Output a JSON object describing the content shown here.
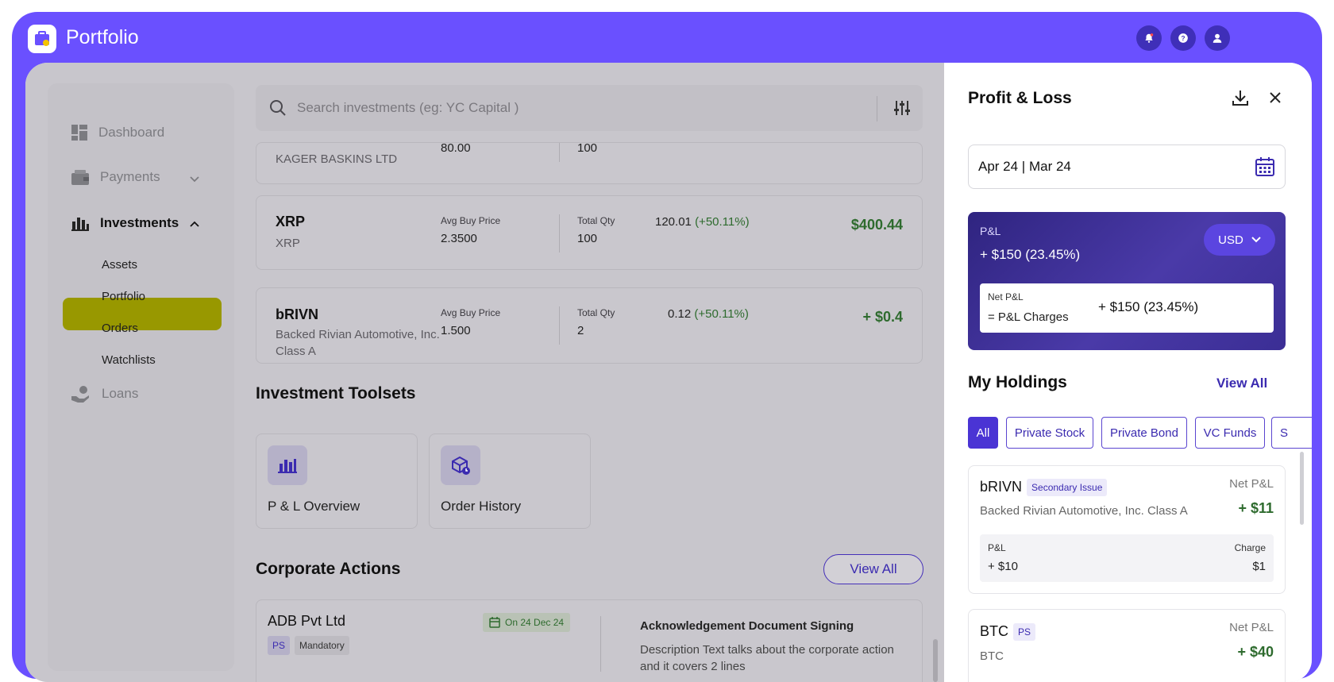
{
  "app": {
    "title": "Portfolio"
  },
  "header": {
    "icons": [
      "bell-icon",
      "help-icon",
      "user-icon"
    ]
  },
  "sidebar": {
    "items": [
      {
        "label": "Dashboard",
        "icon": "dashboard-icon"
      },
      {
        "label": "Payments",
        "icon": "wallet-icon"
      },
      {
        "label": "Investments",
        "icon": "bar-chart-icon"
      },
      {
        "label": "Loans",
        "icon": "hand-coin-icon"
      }
    ],
    "sub_items": [
      "Assets",
      "Portfolio",
      "Orders",
      "Watchlists"
    ],
    "active": "Portfolio"
  },
  "search": {
    "placeholder": "Search investments (eg: YC Capital )"
  },
  "investments": [
    {
      "name": "KAGER BASKINS LTD",
      "avg_buy": "80.00",
      "qty": "100"
    },
    {
      "symbol": "XRP",
      "name": "XRP",
      "avg_buy_label": "Avg Buy Price",
      "avg_buy": "2.3500",
      "qty_label": "Total Qty",
      "qty": "100",
      "pnl": "120.01",
      "pnl_pct": "(+50.11%)",
      "amount": "$400.44"
    },
    {
      "symbol": "bRIVN",
      "name": "Backed Rivian Automotive, Inc. Class A",
      "avg_buy_label": "Avg Buy Price",
      "avg_buy": "1.500",
      "qty_label": "Total Qty",
      "qty": "2",
      "pnl": "0.12",
      "pnl_pct": "(+50.11%)",
      "amount": "+ $0.4"
    }
  ],
  "toolsets": {
    "title": "Investment Toolsets",
    "items": [
      {
        "label": "P & L Overview",
        "icon": "bar-chart-icon"
      },
      {
        "label": "Order History",
        "icon": "box-clock-icon"
      }
    ]
  },
  "corporate": {
    "title": "Corporate Actions",
    "view_all": "View All",
    "item": {
      "company": "ADB Pvt Ltd",
      "tag": "PS",
      "badge": "Mandatory",
      "date": "On 24 Dec 24",
      "action_title": "Acknowledgement Document Signing",
      "description": "Description Text talks about the  corporate action and it covers 2 lines"
    }
  },
  "panel": {
    "title": "Profit & Loss",
    "date_range": "Apr 24 | Mar 24",
    "pnl_card": {
      "label": "P&L",
      "value": "+ $150 (23.45%)",
      "currency": "USD",
      "net_label": "Net P&L",
      "net_sub": "= P&L Charges",
      "net_value": "+ $150 (23.45%)"
    },
    "holdings": {
      "title": "My Holdings",
      "view_all": "View All",
      "filters": [
        "All",
        "Private Stock",
        "Private Bond",
        "VC Funds",
        "S"
      ],
      "active_filter": "All",
      "items": [
        {
          "symbol": "bRIVN",
          "tag": "Secondary Issue",
          "name": "Backed Rivian Automotive, Inc. Class A",
          "net_label": "Net P&L",
          "net_value": "+ $11",
          "pl_label": "P&L",
          "pl_value": "+ $10",
          "charge_label": "Charge",
          "charge_value": "$1"
        },
        {
          "symbol": "BTC",
          "tag": "PS",
          "name": "BTC",
          "net_label": "Net P&L",
          "net_value": "+ $40"
        }
      ]
    }
  },
  "colors": {
    "brand": "#6a50ff",
    "active_nav": "#989800",
    "profit": "#2e6b2e",
    "accent": "#3b2bb0"
  }
}
